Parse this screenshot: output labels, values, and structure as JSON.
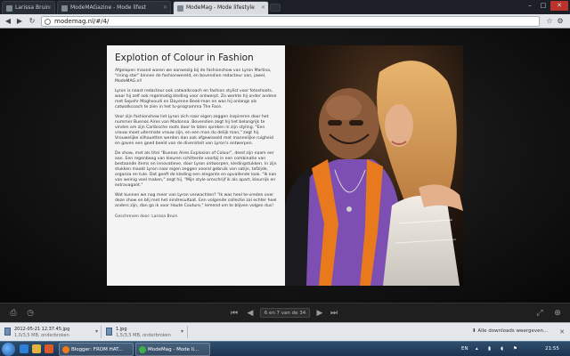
{
  "browser": {
    "tabs": [
      {
        "label": "Larissa Bruin",
        "active": false
      },
      {
        "label": "ModeMAGazine - Mode lifest",
        "active": false
      },
      {
        "label": "ModeMag - Mode lifestyle",
        "active": true
      }
    ],
    "url": "modemag.nl/#/4/"
  },
  "article": {
    "title": "Explotion of Colour in Fashion",
    "paragraphs": [
      "Afgelopen maand waren we aanwezig bij de fashionshow van Lyron Martina, \"rising star\" binnen de fashionwereld, en bovendien redacteur van, jawel, ModeMAG.nl!",
      "Lyron is naast redacteur ook catwalkcoach en fashion stylist voor fotoshoots, waar hij zelf ook regelmatig kleding voor ontwerpt. Zo werkte hij onder andere met Sepehr Maghsoudi en Dayenne Beek-man en was hij onlangs als catwalkcoach te zien in het tv-programma The Face.",
      "Voor zijn fashionshow liet Lyron zich naar eigen zeggen inspireren door het nummer Buenos Aires van Madonna. Bovendien zegt hij het belangrijk te vinden om zijn Caribische roots door te laten spreken in zijn styling. \"Een vrouw moet uitermate vrouw zijn, en een man du delijk man,\" zegt hij. Vrouwelijke silhouetten werden dan ook afgewisseld met mannelijke ruigheid en gaven een goed beeld van de diversiteit van Lyron's ontwerpen.",
      "De show, met als titel \"Buenos Aires Explosion of Colour\", deed zijn naam eer aan. Een regenboog van kleuren schitterde voorbij in een combinatie van bestaande items en innovatieve, door Lyron ontworpen, kledingstukken. In zijn stukken maakt Lyron naar eigen zeggen vooral gebruik van satijn, tafzijde, organza en tule. Dat geeft de kleding een elegante en opvallende look. \"Ik kan van weinig veel maken,\" zegt hij. \"Mijn style omschrijf ik als apart, kleurrijk en extravagant.\"",
      "Wat kunnen we nog meer van Lyron verwachten? \"Ik was heel te-vreden over deze show en blij met het eindresultaat. Een volgende collectie zal echter heel anders zijn, dan ga ik voor Haute Couture,\" lemend om te blijven volgen dus!"
    ],
    "credit": "Geschreven door: Larissa Bruin"
  },
  "viewer": {
    "page_indicator": "6 en 7 van de 34"
  },
  "downloads": {
    "items": [
      {
        "name": "2012-05-21 12.37.45.jpg",
        "size": "1,0/3,5 MB, onderbroken"
      },
      {
        "name": "1.jpg",
        "size": "1,5/3,5 MB, onderbroken"
      }
    ],
    "all_label": "Alle downloads weergeven..."
  },
  "taskbar": {
    "tasks": [
      {
        "label": "Blogger: FROM HAT..."
      },
      {
        "label": "ModeMag - Mode li..."
      }
    ],
    "lang": "EN",
    "time": "21:55"
  },
  "colors": {
    "accent_orange": "#e87a1d",
    "accent_purple": "#7d4fb3",
    "page_bg": "#f4f4f4"
  }
}
